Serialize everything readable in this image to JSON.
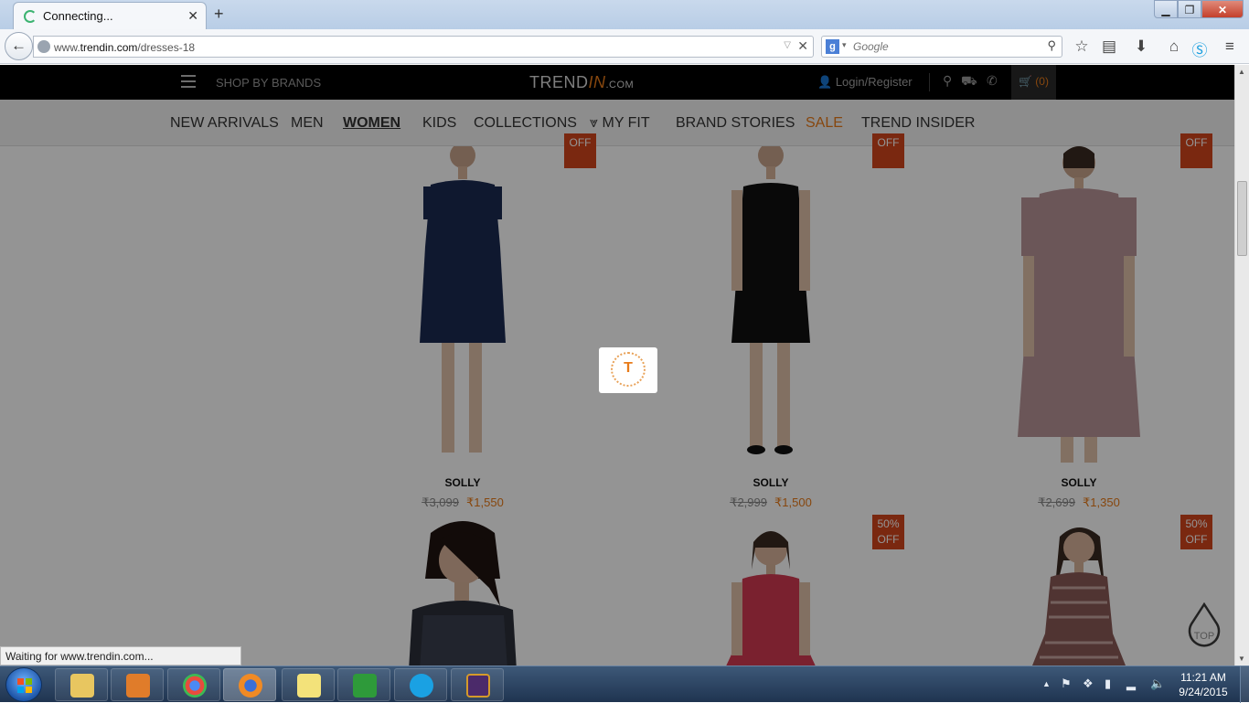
{
  "browser": {
    "tab_title": "Connecting...",
    "new_tab": "+",
    "window_controls": {
      "minimize": "▁",
      "maximize": "❐",
      "close": "✕"
    },
    "url_prefix": "www.",
    "url_host": "trendin.com",
    "url_path": "/dresses-18",
    "search_placeholder": "Google",
    "status_text": "Waiting for www.trendin.com..."
  },
  "site": {
    "shop_by_brands": "SHOP BY BRANDS",
    "logo_main": "TREND",
    "logo_in": "IN",
    "logo_com": ".COM",
    "login": "Login/Register",
    "cart": "(0)",
    "menu": [
      {
        "label": "NEW ARRIVALS",
        "state": "normal"
      },
      {
        "label": "MEN",
        "state": "normal"
      },
      {
        "label": "WOMEN",
        "state": "active"
      },
      {
        "label": "KIDS",
        "state": "normal"
      },
      {
        "label": "COLLECTIONS",
        "state": "normal"
      },
      {
        "label": "MY FIT",
        "state": "normal"
      },
      {
        "label": "BRAND STORIES",
        "state": "normal"
      },
      {
        "label": "SALE",
        "state": "sale"
      },
      {
        "label": "TREND INSIDER",
        "state": "normal"
      }
    ],
    "badge_partial": "OFF",
    "products_row1": [
      {
        "brand": "SOLLY",
        "old_price": "3,099",
        "new_price": "1,550",
        "dress_color": "#1b2a52"
      },
      {
        "brand": "SOLLY",
        "old_price": "2,999",
        "new_price": "1,500",
        "dress_color": "#111111"
      },
      {
        "brand": "SOLLY",
        "old_price": "2,699",
        "new_price": "1,350",
        "dress_color": "#b89498"
      }
    ],
    "products_row2": [
      {
        "badge": "",
        "dress_color": "#2b2f3a"
      },
      {
        "badge": "50%\nOFF",
        "dress_color": "#d23a52"
      },
      {
        "badge": "50%\nOFF",
        "dress_color": "#8a5b57"
      }
    ],
    "rupee": "₹",
    "loader_letter": "T",
    "top_button": "TOP"
  },
  "taskbar": {
    "time": "11:21 AM",
    "date": "9/24/2015",
    "apps": [
      "file-explorer",
      "media-player",
      "chrome",
      "firefox",
      "sticky-notes",
      "spreadsheet",
      "skype",
      "java-ee-ide"
    ]
  },
  "colors": {
    "accent": "#e87b19",
    "badge": "#d2451c",
    "topbar": "#000000"
  }
}
